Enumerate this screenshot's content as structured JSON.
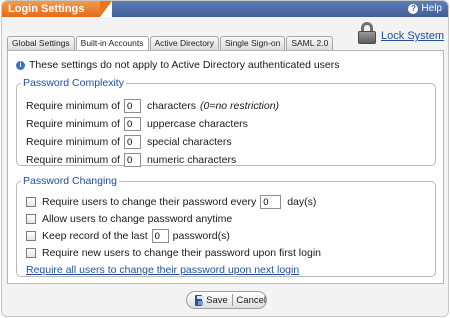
{
  "window": {
    "title": "Login Settings",
    "help_label": "Help"
  },
  "lock_system": {
    "label": "Lock System"
  },
  "tabs": [
    {
      "label": "Global Settings",
      "active": false
    },
    {
      "label": "Built-in Accounts",
      "active": true
    },
    {
      "label": "Active Directory",
      "active": false
    },
    {
      "label": "Single Sign-on",
      "active": false
    },
    {
      "label": "SAML 2.0",
      "active": false
    }
  ],
  "notice": "These settings do not apply to Active Directory authenticated users",
  "password_complexity": {
    "legend": "Password Complexity",
    "rows": [
      {
        "prefix": "Require minimum of",
        "value": "0",
        "suffix": "characters",
        "note": "(0=no restriction)"
      },
      {
        "prefix": "Require minimum of",
        "value": "0",
        "suffix": "uppercase characters"
      },
      {
        "prefix": "Require minimum of",
        "value": "0",
        "suffix": "special characters"
      },
      {
        "prefix": "Require minimum of",
        "value": "0",
        "suffix": "numeric characters"
      }
    ]
  },
  "password_changing": {
    "legend": "Password Changing",
    "change_every": {
      "prefix": "Require users to change their password every",
      "value": "0",
      "suffix": "day(s)"
    },
    "allow_anytime": {
      "label": "Allow users to change password anytime"
    },
    "keep_record": {
      "prefix": "Keep record of the last",
      "value": "0",
      "suffix": "password(s)"
    },
    "first_login": {
      "label": "Require new users to change their password upon first login"
    },
    "next_login_link": "Require all users to change their password upon next login"
  },
  "footer": {
    "save_label": "Save",
    "cancel_label": "Cancel"
  },
  "colors": {
    "title_orange": "#e36c17",
    "title_blue": "#3e5f96",
    "link": "#1f4e9a"
  }
}
